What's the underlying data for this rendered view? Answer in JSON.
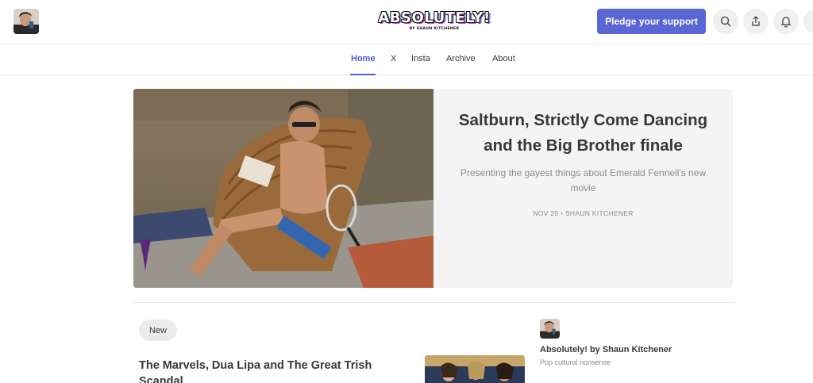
{
  "header": {
    "logo_text": "ABSOLUTELY!",
    "logo_subtitle": "BY SHAUN KITCHENER",
    "pledge_label": "Pledge your support",
    "icons": [
      "search-icon",
      "share-icon",
      "bell-icon"
    ]
  },
  "nav": {
    "items": [
      {
        "label": "Home"
      },
      {
        "label": "X"
      },
      {
        "label": "Insta"
      },
      {
        "label": "Archive"
      },
      {
        "label": "About"
      }
    ]
  },
  "hero": {
    "title": "Saltburn, Strictly Come Dancing and the Big Brother finale",
    "subtitle": "Presenting the gayest things about Emerald Fennell's new movie",
    "meta": "NOV 20 • SHAUN KITCHENER"
  },
  "feed": {
    "tab_label": "New",
    "post_title": "The Marvels, Dua Lipa and The Great Trish Scandal"
  },
  "sidebar": {
    "pub_name": "Absolutely! by Shaun Kitchener",
    "pub_description": "Pop cultural nonsense"
  },
  "colors": {
    "accent": "#5a66d4",
    "nav_active": "#4f5bd5",
    "hero_bg": "#f4f4f4",
    "muted_text": "#8a8a8a"
  }
}
